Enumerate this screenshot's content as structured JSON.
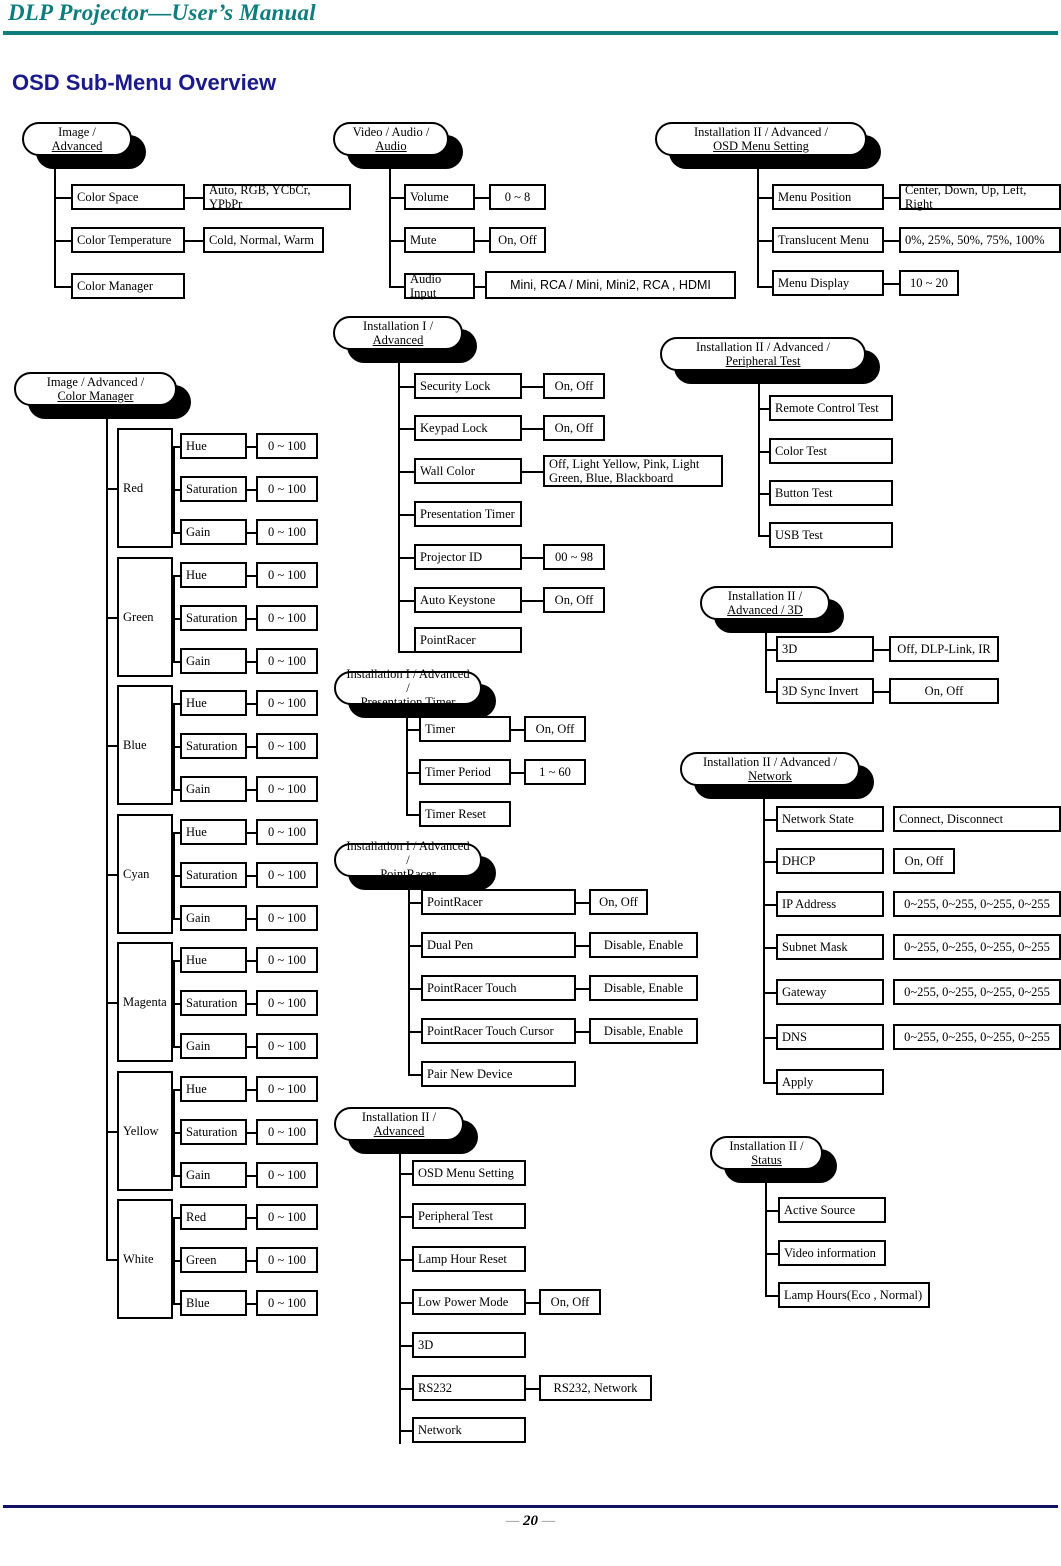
{
  "header": {
    "manual_title": "DLP Projector—User’s Manual",
    "section_title": "OSD Sub-Menu Overview"
  },
  "footer": {
    "page_number": "20",
    "dash_left": "—",
    "dash_right": "—"
  },
  "colors": {
    "header_rule": "#0d7d7d",
    "header_text": "#0d7d7d",
    "section_title": "#1a1a8c",
    "footer_rule": "#111166",
    "node_border": "#000000",
    "node_fill": "#ffffff"
  },
  "groups": {
    "image_advanced": {
      "heading_line1": "Image /",
      "heading_line2": "Advanced",
      "items": [
        {
          "label": "Color Space",
          "value": "Auto, RGB, YCbCr, YPbPr"
        },
        {
          "label": "Color Temperature",
          "value": "Cold, Normal, Warm"
        },
        {
          "label": "Color Manager",
          "value": ""
        }
      ]
    },
    "video_audio": {
      "heading_line1": "Video / Audio /",
      "heading_line2": "Audio",
      "items": [
        {
          "label": "Volume",
          "value": "0 ~ 8"
        },
        {
          "label": "Mute",
          "value": "On, Off"
        },
        {
          "label": "Audio Input",
          "value": "Mini, RCA / Mini, Mini2, RCA , HDMI"
        }
      ]
    },
    "osd_menu_setting": {
      "heading_line1": "Installation II / Advanced /",
      "heading_line2": "OSD Menu Setting",
      "items": [
        {
          "label": "Menu Position",
          "value": "Center, Down, Up, Left, Right"
        },
        {
          "label": "Translucent Menu",
          "value": "0%, 25%, 50%, 75%, 100%"
        },
        {
          "label": "Menu Display",
          "value": "10 ~ 20"
        }
      ]
    },
    "color_manager": {
      "heading_line1": "Image / Advanced /",
      "heading_line2": "Color Manager",
      "channels": [
        {
          "name": "Red",
          "rows": [
            {
              "label": "Hue",
              "value": "0 ~ 100"
            },
            {
              "label": "Saturation",
              "value": "0 ~ 100"
            },
            {
              "label": "Gain",
              "value": "0 ~ 100"
            }
          ]
        },
        {
          "name": "Green",
          "rows": [
            {
              "label": "Hue",
              "value": "0 ~ 100"
            },
            {
              "label": "Saturation",
              "value": "0 ~ 100"
            },
            {
              "label": "Gain",
              "value": "0 ~ 100"
            }
          ]
        },
        {
          "name": "Blue",
          "rows": [
            {
              "label": "Hue",
              "value": "0 ~ 100"
            },
            {
              "label": "Saturation",
              "value": "0 ~ 100"
            },
            {
              "label": "Gain",
              "value": "0 ~ 100"
            }
          ]
        },
        {
          "name": "Cyan",
          "rows": [
            {
              "label": "Hue",
              "value": "0 ~ 100"
            },
            {
              "label": "Saturation",
              "value": "0 ~ 100"
            },
            {
              "label": "Gain",
              "value": "0 ~ 100"
            }
          ]
        },
        {
          "name": "Magenta",
          "rows": [
            {
              "label": "Hue",
              "value": "0 ~ 100"
            },
            {
              "label": "Saturation",
              "value": "0 ~ 100"
            },
            {
              "label": "Gain",
              "value": "0 ~ 100"
            }
          ]
        },
        {
          "name": "Yellow",
          "rows": [
            {
              "label": "Hue",
              "value": "0 ~ 100"
            },
            {
              "label": "Saturation",
              "value": "0 ~ 100"
            },
            {
              "label": "Gain",
              "value": "0 ~ 100"
            }
          ]
        },
        {
          "name": "White",
          "rows": [
            {
              "label": "Red",
              "value": "0 ~ 100"
            },
            {
              "label": "Green",
              "value": "0 ~ 100"
            },
            {
              "label": "Blue",
              "value": "0 ~ 100"
            }
          ]
        }
      ]
    },
    "installation_i_advanced": {
      "heading_line1": "Installation I /",
      "heading_line2": "Advanced",
      "items": [
        {
          "label": "Security Lock",
          "value": "On, Off"
        },
        {
          "label": "Keypad Lock",
          "value": "On, Off"
        },
        {
          "label": "Wall Color",
          "value": "Off, Light Yellow, Pink, Light\nGreen, Blue, Blackboard"
        },
        {
          "label": "Presentation Timer",
          "value": ""
        },
        {
          "label": "Projector ID",
          "value": "00 ~ 98"
        },
        {
          "label": "Auto Keystone",
          "value": "On, Off"
        },
        {
          "label": "PointRacer",
          "value": ""
        }
      ]
    },
    "presentation_timer": {
      "heading_line1": "Installation I / Advanced /",
      "heading_line2": "Presentation Timer",
      "items": [
        {
          "label": "Timer",
          "value": "On, Off"
        },
        {
          "label": "Timer Period",
          "value": "1 ~ 60"
        },
        {
          "label": "Timer Reset",
          "value": ""
        }
      ]
    },
    "pointracer": {
      "heading_line1": "Installation I / Advanced /",
      "heading_line2": "PointRacer",
      "items": [
        {
          "label": "PointRacer",
          "value": "On, Off"
        },
        {
          "label": "Dual Pen",
          "value": "Disable, Enable"
        },
        {
          "label": "PointRacer Touch",
          "value": "Disable, Enable"
        },
        {
          "label": "PointRacer Touch Cursor",
          "value": "Disable, Enable"
        },
        {
          "label": "Pair New Device",
          "value": ""
        }
      ]
    },
    "installation_ii_advanced": {
      "heading_line1": "Installation II /",
      "heading_line2": "Advanced",
      "items": [
        {
          "label": "OSD Menu Setting",
          "value": ""
        },
        {
          "label": "Peripheral Test",
          "value": ""
        },
        {
          "label": "Lamp Hour Reset",
          "value": ""
        },
        {
          "label": "Low Power Mode",
          "value": "On, Off"
        },
        {
          "label": "3D",
          "value": ""
        },
        {
          "label": "RS232",
          "value": "RS232, Network"
        },
        {
          "label": "Network",
          "value": ""
        }
      ]
    },
    "peripheral_test": {
      "heading_line1": "Installation II / Advanced /",
      "heading_line2": "Peripheral Test",
      "items": [
        {
          "label": "Remote Control Test",
          "value": ""
        },
        {
          "label": "Color Test",
          "value": ""
        },
        {
          "label": "Button Test",
          "value": ""
        },
        {
          "label": "USB Test",
          "value": ""
        }
      ]
    },
    "three_d": {
      "heading_line1": "Installation II /",
      "heading_line2": "Advanced / 3D",
      "items": [
        {
          "label": "3D",
          "value": "Off, DLP-Link, IR"
        },
        {
          "label": "3D Sync Invert",
          "value": "On, Off"
        }
      ]
    },
    "network": {
      "heading_line1": "Installation II / Advanced /",
      "heading_line2": "Network",
      "items": [
        {
          "label": "Network State",
          "value": "Connect, Disconnect"
        },
        {
          "label": "DHCP",
          "value": "On, Off"
        },
        {
          "label": "IP Address",
          "value": "0~255, 0~255, 0~255, 0~255"
        },
        {
          "label": "Subnet Mask",
          "value": "0~255, 0~255, 0~255, 0~255"
        },
        {
          "label": "Gateway",
          "value": "0~255, 0~255, 0~255, 0~255"
        },
        {
          "label": "DNS",
          "value": "0~255, 0~255, 0~255, 0~255"
        },
        {
          "label": "Apply",
          "value": ""
        }
      ]
    },
    "status": {
      "heading_line1": "Installation II /",
      "heading_line2": "Status",
      "items": [
        {
          "label": "Active Source",
          "value": ""
        },
        {
          "label": "Video information",
          "value": ""
        },
        {
          "label": "Lamp Hours(Eco , Normal)",
          "value": ""
        }
      ]
    }
  }
}
